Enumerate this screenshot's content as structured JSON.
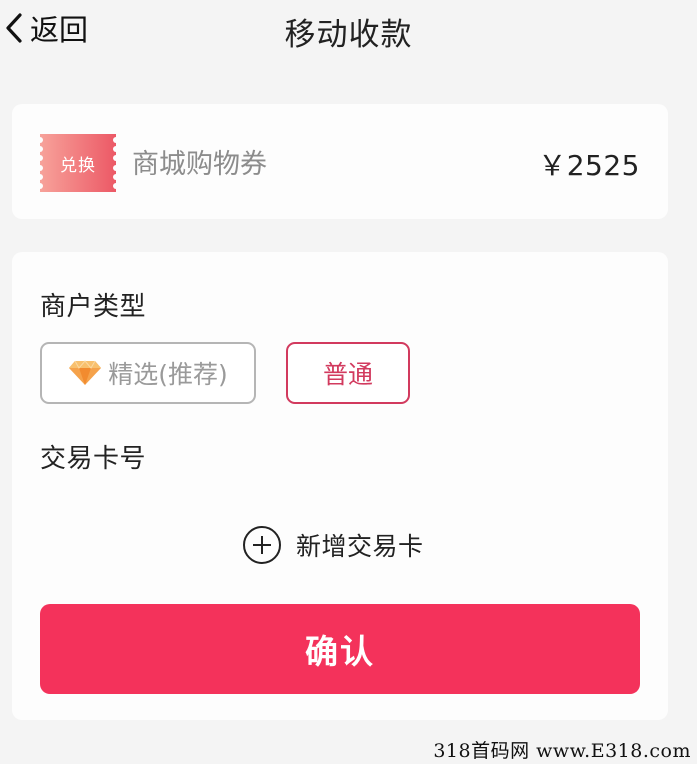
{
  "header": {
    "back_label": "返回",
    "title": "移动收款"
  },
  "voucher": {
    "badge_text": "兑换",
    "label": "商城购物券",
    "amount": "￥2525"
  },
  "merchant_type": {
    "label": "商户类型",
    "options": [
      {
        "label": "精选(推荐)",
        "icon": "diamond-icon",
        "selected": false
      },
      {
        "label": "普通",
        "selected": true
      }
    ]
  },
  "trade_card": {
    "label": "交易卡号",
    "add_label": "新增交易卡"
  },
  "confirm_label": "确认",
  "watermark": "318首码网 www.E318.com",
  "colors": {
    "accent": "#f4325b",
    "selected_border": "#d23a5e",
    "badge": "#f06a72",
    "gem": "#f5a24b"
  }
}
